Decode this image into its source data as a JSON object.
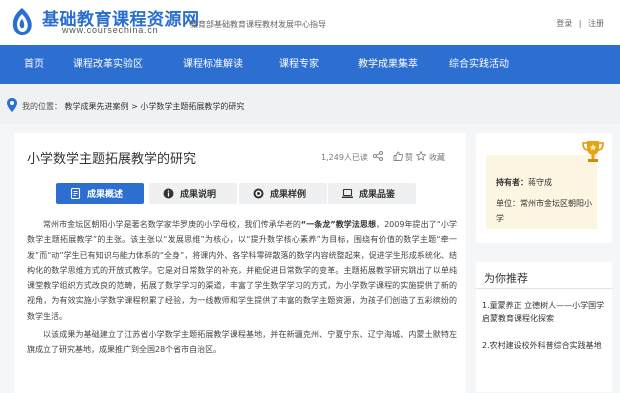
{
  "header": {
    "site_name": "基础教育课程资源网",
    "site_url": "www.coursechina.cn",
    "slogan": "教育部基础教育课程教材发展中心指导",
    "login": "登录",
    "divider": "|",
    "register": "注册"
  },
  "nav": {
    "items": [
      "首页",
      "课程改革实验区",
      "课程标准解读",
      "课程专家",
      "教学成果集萃",
      "综合实践活动"
    ]
  },
  "breadcrumb": {
    "prefix": "我的位置：",
    "path": "教学成果先进案例 > 小学数学主题拓展教学的研究"
  },
  "article": {
    "title": "小学数学主题拓展教学的研究",
    "reads": "1,249人已读",
    "like_label": "赞",
    "collect_label": "收藏",
    "tabs": [
      {
        "label": "成果概述",
        "icon": "document-icon",
        "active": true
      },
      {
        "label": "成果说明",
        "icon": "info-icon",
        "active": false
      },
      {
        "label": "成果样例",
        "icon": "target-icon",
        "active": false
      },
      {
        "label": "成果品鉴",
        "icon": "laptop-icon",
        "active": false
      }
    ],
    "p1_a": "常州市金坛区朝阳小学是著名数学家华罗庚的小学母校，我们传承华老的",
    "p1_highlight": "“一条龙”教学法思想",
    "p1_b": "，2009年提出了“小学数学主题拓展教学”的主张。该主张以“发展思维”为核心，以“提升数学核心素养”为目标，围绕有价值的数学主题“牵一发”而“动”学生已有知识与能力体系的“全身”，将课内外、各学科零碎散落的数学内容统整起来，促进学生形成系统化、结构化的数学思维方式的开放式教学。它是对日常数学的补充，并能促进日常数学的变革。主题拓展教学研究跳出了以单纯课堂教学组织方式改良的范畴，拓展了数学学习的渠道，丰富了学生数学学习的方式，为小学数学课程的实施提供了新的视角，为有效实施小学数学课程积累了经验，为一线教师和学生提供了丰富的数学主题资源，为孩子们创造了五彩缤纷的数学生活。",
    "p2": "以该成果为基础建立了江苏省小学数学主题拓展教学课程基地，并在新疆克州、宁夏宁东、辽宁海城、内蒙土默特左旗成立了研究基地，成果推广到全国28个省市自治区。"
  },
  "sidebar": {
    "owner_label": "持有者：",
    "owner_name": "蒋守成",
    "unit_label": "单位：",
    "unit_name": "常州市金坛区朝阳小学",
    "recommend_title": "为你推荐",
    "recommend": [
      "1.童蒙养正 立德树人——小学国学启蒙教育课程化探索",
      "2.农村建设校外科普综合实践基地"
    ]
  },
  "colors": {
    "brand_blue": "#2c6fd1",
    "profile_bg": "#fbf5e1",
    "trophy_gold": "#e8a21a"
  }
}
